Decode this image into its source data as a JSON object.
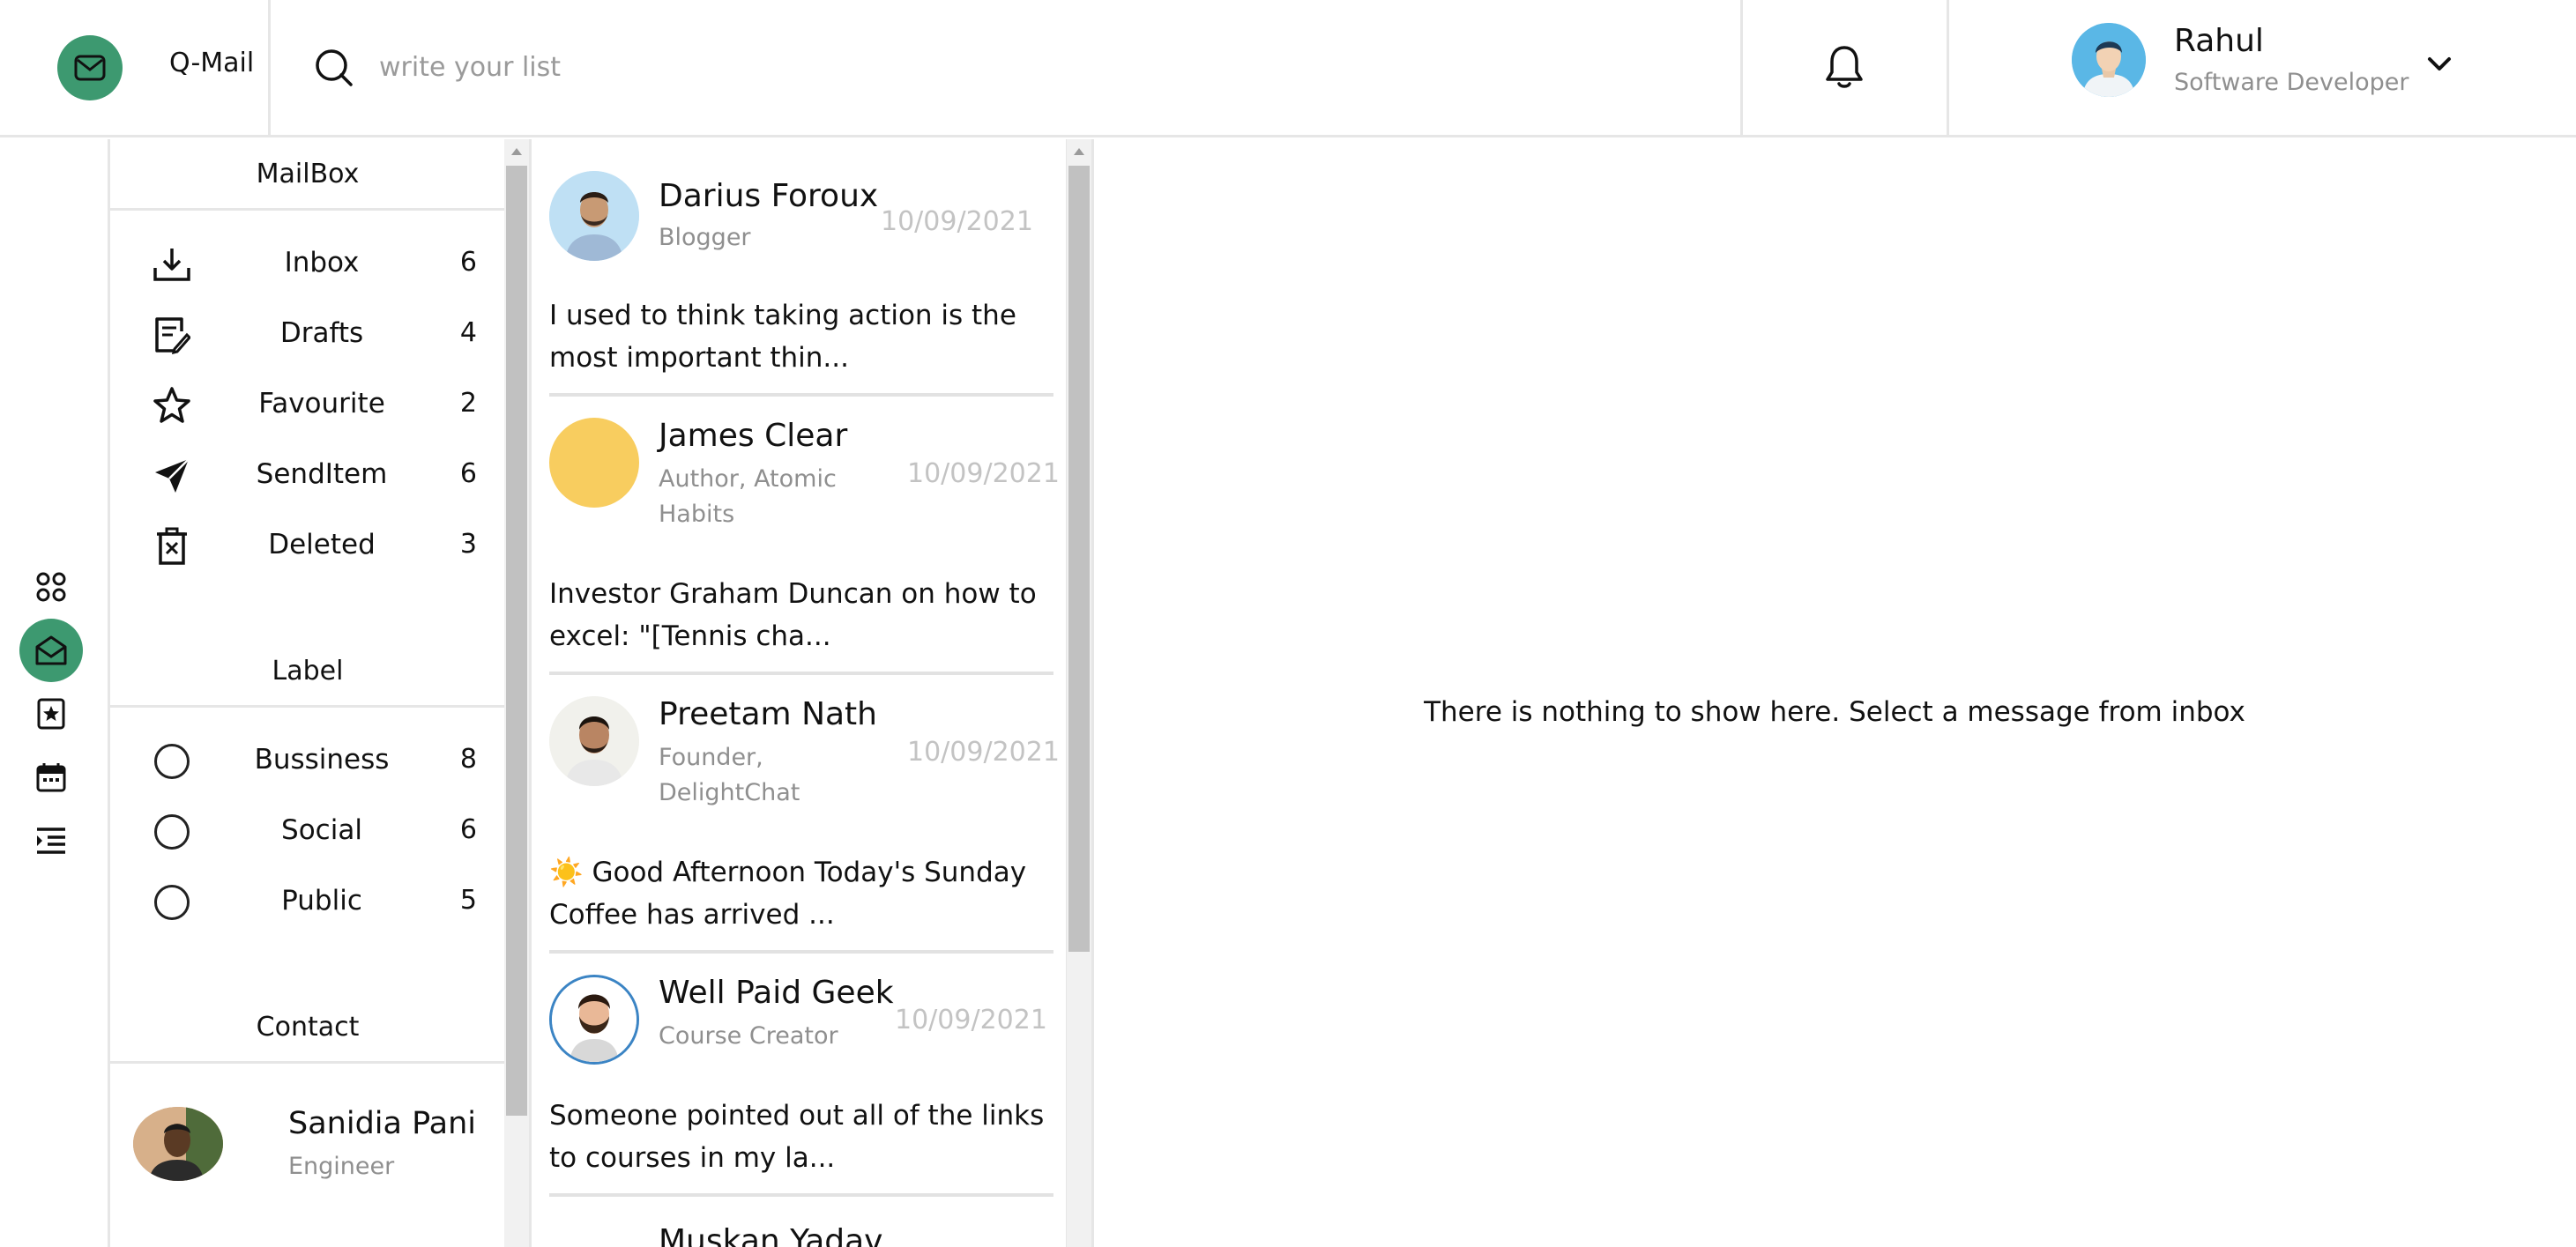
{
  "app": {
    "name": "Q-Mail",
    "accent_color": "#3d9970"
  },
  "search": {
    "placeholder": "write your list"
  },
  "user": {
    "name": "Rahul",
    "role": "Software Developer"
  },
  "rail": [
    "apps-icon",
    "mail-icon",
    "bookmark-star-icon",
    "calendar-icon",
    "list-indent-icon"
  ],
  "mailbox": {
    "title": "MailBox",
    "items": [
      {
        "label": "Inbox",
        "count": "6",
        "icon": "inbox-download-icon"
      },
      {
        "label": "Drafts",
        "count": "4",
        "icon": "drafts-edit-icon"
      },
      {
        "label": "Favourite",
        "count": "2",
        "icon": "star-icon"
      },
      {
        "label": "SendItem",
        "count": "6",
        "icon": "send-icon"
      },
      {
        "label": "Deleted",
        "count": "3",
        "icon": "trash-icon"
      }
    ]
  },
  "labels": {
    "title": "Label",
    "items": [
      {
        "label": "Bussiness",
        "count": "8"
      },
      {
        "label": "Social",
        "count": "6"
      },
      {
        "label": "Public",
        "count": "5"
      }
    ]
  },
  "contacts": {
    "title": "Contact",
    "items": [
      {
        "name": "Sanidia Pani",
        "role": "Engineer"
      }
    ]
  },
  "messages": [
    {
      "name": "Darius Foroux",
      "role": "Blogger",
      "date": "10/09/2021",
      "preview": "I used to think taking action is the most important thin..."
    },
    {
      "name": "James Clear",
      "role": "Author, Atomic Habits",
      "date": "10/09/2021",
      "preview": "Investor Graham Duncan on how to excel: \"[Tennis cha..."
    },
    {
      "name": "Preetam Nath",
      "role": "Founder, DelightChat",
      "date": "10/09/2021",
      "preview": "☀️ Good Afternoon Today's Sunday Coffee has arrived ..."
    },
    {
      "name": "Well Paid Geek",
      "role": "Course Creator",
      "date": "10/09/2021",
      "preview": "Someone pointed out all of the links to courses in my la..."
    },
    {
      "name": "Muskan Yadav"
    }
  ],
  "reading_pane": {
    "empty_text": "There is nothing to show here. Select a message from inbox"
  }
}
